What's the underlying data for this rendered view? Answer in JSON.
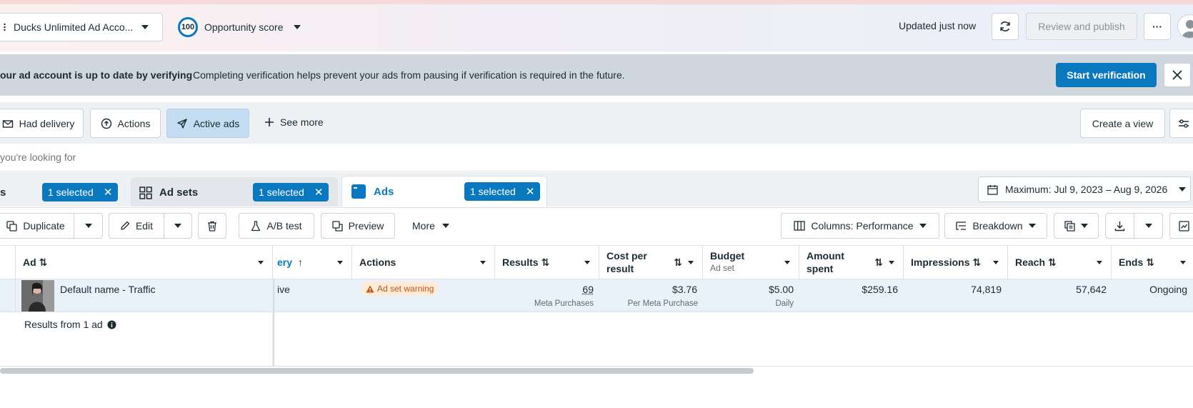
{
  "topbar": {
    "account_name": "Ducks Unlimited Ad Acco...",
    "opportunity_value": "100",
    "opportunity_label": "Opportunity score",
    "updated_text": "Updated just now",
    "review_publish_label": "Review and publish",
    "more_label": "···"
  },
  "banner": {
    "title": "our ad account is up to date by verifying",
    "message": "Completing verification helps prevent your ads from pausing if verification is required in the future.",
    "cta_label": "Start verification"
  },
  "filters": {
    "had_delivery": "Had delivery",
    "actions": "Actions",
    "active_ads": "Active ads",
    "see_more": "See more",
    "create_view": "Create a view"
  },
  "search": {
    "placeholder": "you're looking for"
  },
  "tabs": {
    "campaigns_partial": "s",
    "campaigns_selected": "1 selected",
    "adsets_label": "Ad sets",
    "adsets_selected": "1 selected",
    "ads_label": "Ads",
    "ads_selected": "1 selected",
    "date_range": "Maximum: Jul 9, 2023 – Aug 9, 2026"
  },
  "toolbar": {
    "duplicate": "Duplicate",
    "edit": "Edit",
    "ab_test": "A/B test",
    "preview": "Preview",
    "more": "More",
    "columns": "Columns: Performance",
    "breakdown": "Breakdown"
  },
  "table": {
    "headers": {
      "ad": "Ad",
      "delivery_partial": "ery",
      "actions": "Actions",
      "results": "Results",
      "cost_per_result_1": "Cost per",
      "cost_per_result_2": "result",
      "budget": "Budget",
      "budget_sub": "Ad set",
      "amount_spent_1": "Amount",
      "amount_spent_2": "spent",
      "impressions": "Impressions",
      "reach": "Reach",
      "ends": "Ends"
    },
    "row": {
      "ad_name": "Default name - Traffic",
      "delivery_partial": "ive",
      "warning": "Ad set warning",
      "results": "69",
      "results_sub": "Meta Purchases",
      "cost": "$3.76",
      "cost_sub": "Per Meta Purchase",
      "budget": "$5.00",
      "budget_sub": "Daily",
      "amount_spent": "$259.16",
      "impressions": "74,819",
      "reach": "57,642",
      "ends": "Ongoing"
    },
    "footer": "Results from 1 ad"
  },
  "colors": {
    "accent": "#0a78be",
    "banner_bg": "#cfd6de",
    "warning": "#c0541a"
  }
}
